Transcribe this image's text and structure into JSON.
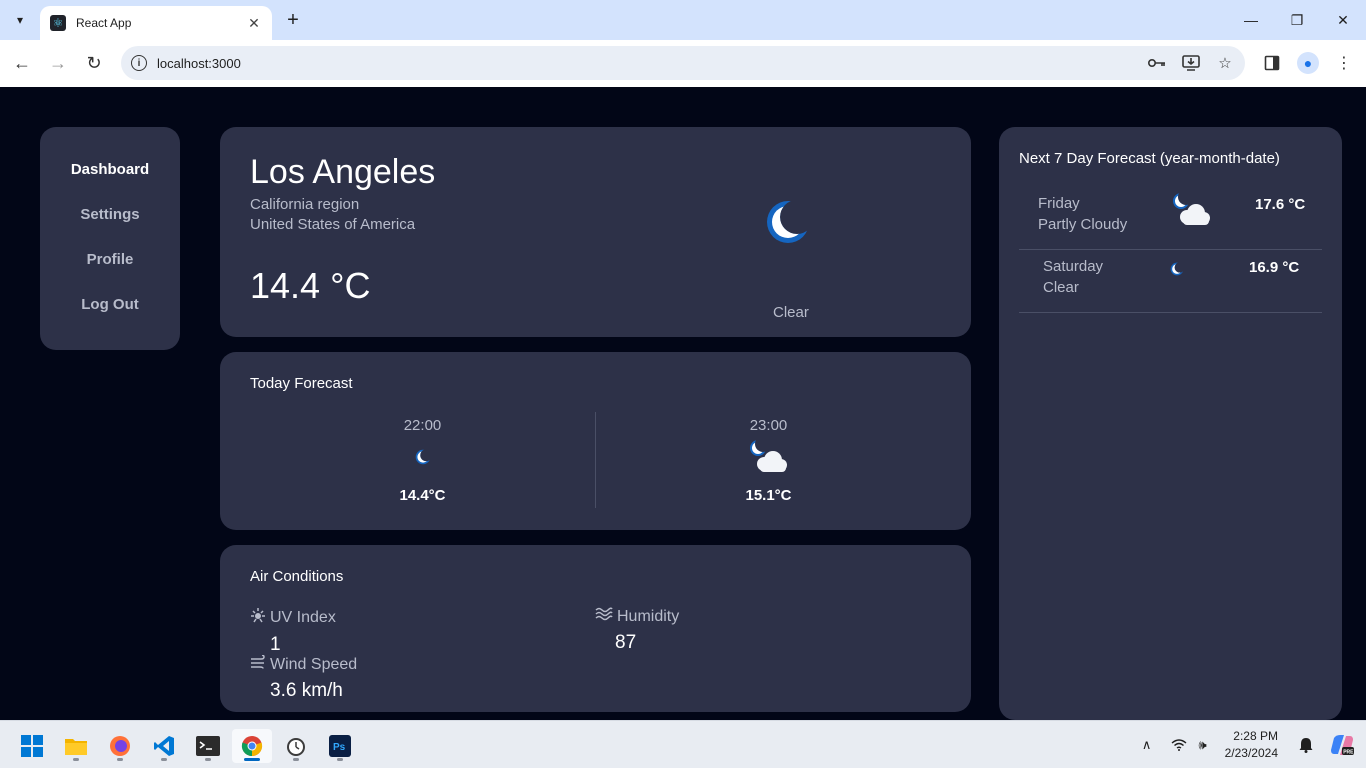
{
  "browser": {
    "tab_title": "React App",
    "url": "localhost:3000"
  },
  "sidebar": {
    "items": [
      {
        "label": "Dashboard",
        "active": true
      },
      {
        "label": "Settings",
        "active": false
      },
      {
        "label": "Profile",
        "active": false
      },
      {
        "label": "Log Out",
        "active": false
      }
    ]
  },
  "current": {
    "city": "Los Angeles",
    "region": "California region",
    "country": "United States of America",
    "temperature": "14.4 °C",
    "condition": "Clear",
    "icon": "moon-icon"
  },
  "today": {
    "title": "Today Forecast",
    "hours": [
      {
        "time": "22:00",
        "icon": "moon-icon",
        "temp": "14.4°C"
      },
      {
        "time": "23:00",
        "icon": "partly-cloudy-night-icon",
        "temp": "15.1°C"
      }
    ]
  },
  "air": {
    "title": "Air Conditions",
    "uv_label": "UV Index",
    "uv_value": "1",
    "humidity_label": "Humidity",
    "humidity_value": "87",
    "wind_label": "Wind Speed",
    "wind_value": "3.6 km/h"
  },
  "week": {
    "title": "Next 7 Day Forecast (year-month-date)",
    "days": [
      {
        "day": "Friday",
        "condition": "Partly Cloudy",
        "temp": "17.6 °C",
        "icon": "partly-cloudy-night-icon"
      },
      {
        "day": "Saturday",
        "condition": "Clear",
        "temp": "16.9 °C",
        "icon": "moon-icon"
      }
    ]
  },
  "taskbar": {
    "time": "2:28 PM",
    "date": "2/23/2024"
  },
  "colors": {
    "background": "#020617",
    "card": "#2d3148",
    "moon": "#1565c0"
  }
}
